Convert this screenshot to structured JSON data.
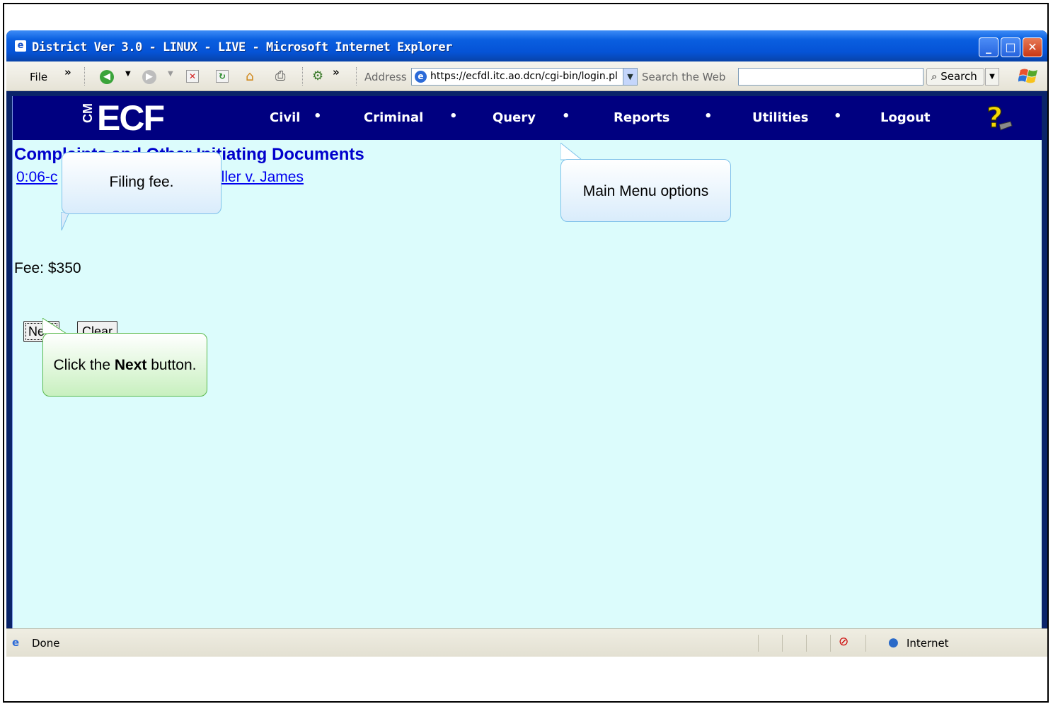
{
  "window": {
    "title": "District Ver 3.0 - LINUX - LIVE - Microsoft Internet Explorer",
    "icon": "ie-page-icon",
    "controls": [
      "minimize-icon",
      "maximize-icon",
      "close-icon"
    ]
  },
  "toolbar": {
    "file_menu": "File",
    "chevron_1": "»",
    "chevron_2": "»",
    "address_label": "Address",
    "address_value": "https://ecfdl.itc.ao.dcn/cgi-bin/login.pl",
    "search_label": "Search the Web",
    "search_value": "",
    "search_button": "Search"
  },
  "ecf": {
    "logo_cm": "CM",
    "logo_ecf": "ECF",
    "menu": [
      {
        "label": "Civil"
      },
      {
        "label": "Criminal"
      },
      {
        "label": "Query"
      },
      {
        "label": "Reports"
      },
      {
        "label": "Utilities"
      },
      {
        "label": "Logout"
      }
    ],
    "menu_dot": "•",
    "banner_color": "#000080"
  },
  "page": {
    "title": "Complaints and Other Initiating Documents",
    "case_link_prefix": "0:06-c",
    "case_link_suffix": "iller v. James",
    "fee_label": "Fee: $350",
    "next_button": "Next",
    "clear_button": "Clear",
    "background_color": "#dcfcfc"
  },
  "callouts": {
    "filing_fee": "Filing fee.",
    "main_menu": "Main Menu options",
    "next_prefix": "Click the ",
    "next_bold": "Next",
    "next_suffix": " button."
  },
  "status": {
    "done": "Done",
    "zone": "Internet"
  }
}
